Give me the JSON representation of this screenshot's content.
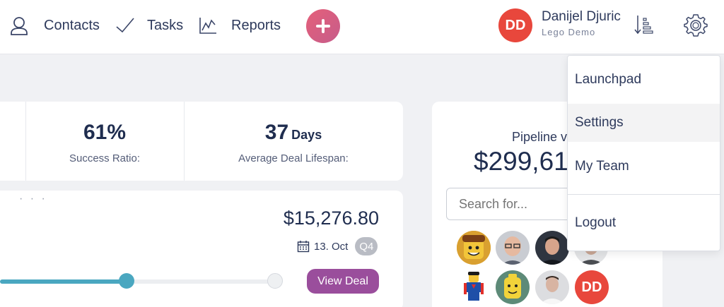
{
  "nav": {
    "contacts": "Contacts",
    "tasks": "Tasks",
    "reports": "Reports"
  },
  "user": {
    "initials": "DD",
    "name": "Danijel Djuric",
    "org": "Lego Demo"
  },
  "stats": {
    "success_ratio_value": "61%",
    "success_ratio_label": "Success Ratio:",
    "lifespan_value": "37",
    "lifespan_unit": "Days",
    "lifespan_label": "Average Deal Lifespan:"
  },
  "deal": {
    "dots": "· · ·",
    "amount": "$15,276.80",
    "date": "13. Oct",
    "quarter": "Q4",
    "progress_fraction": 0.45,
    "view_label": "View Deal"
  },
  "pipeline": {
    "title": "Pipeline v",
    "value": "$299,61",
    "search_placeholder": "Search for...",
    "member_initials": "DD"
  },
  "menu": {
    "launchpad": "Launchpad",
    "settings": "Settings",
    "my_team": "My Team",
    "logout": "Logout"
  },
  "colors": {
    "accent_red": "#e8473c",
    "accent_pink": "#d65f82",
    "accent_teal": "#4aa7c0",
    "accent_purple": "#9a4e9c"
  }
}
